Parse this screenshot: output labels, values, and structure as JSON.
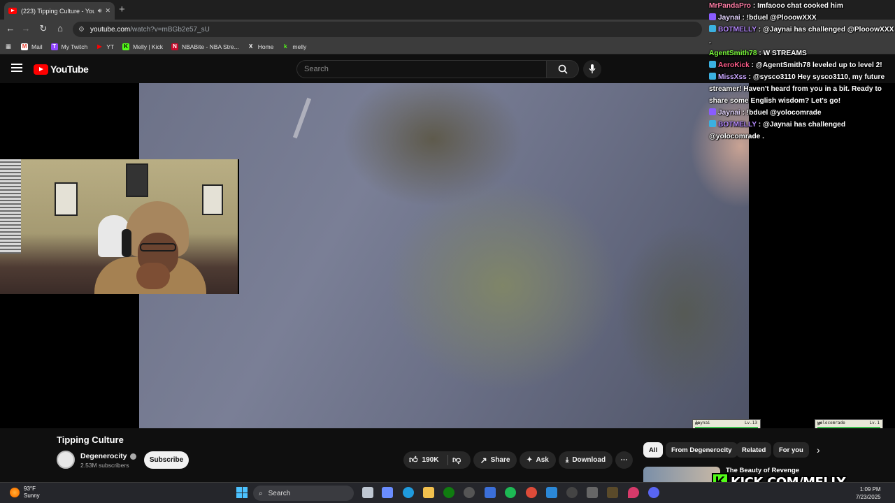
{
  "browser": {
    "tab_title": "(223) Tipping Culture - You",
    "new_tab": "+",
    "url_host": "youtube.com",
    "url_path": "/watch?v=mBGb2e57_sU",
    "bookmarks": [
      {
        "label": "Mail",
        "color": "#ea4335",
        "glyph": "M"
      },
      {
        "label": "My Twitch",
        "color": "#9146ff",
        "glyph": "T"
      },
      {
        "label": "YT",
        "color": "#ff0000",
        "glyph": "▶"
      },
      {
        "label": "Melly | Kick",
        "color": "#53fc18",
        "glyph": "K"
      },
      {
        "label": "NBABite - NBA Stre...",
        "color": "#c9082a",
        "glyph": "N"
      },
      {
        "label": "Home",
        "color": "#ffffff",
        "glyph": "X"
      },
      {
        "label": "melly",
        "color": "#53fc18",
        "glyph": "k"
      }
    ]
  },
  "youtube": {
    "logo": "YouTube",
    "search_placeholder": "Search",
    "video_title": "Tipping Culture",
    "channel_name": "Degenerocity",
    "subscribers": "2.53M subscribers",
    "subscribe_label": "Subscribe",
    "likes": "190K",
    "share_label": "Share",
    "ask_label": "Ask",
    "download_label": "Download",
    "more_label": "⋯",
    "chips": [
      "All",
      "From Degenerocity",
      "Related",
      "For you"
    ],
    "rec_title": "The Beauty of Revenge"
  },
  "chat": [
    {
      "user": "MrPandaPro",
      "user_color": "#ff7fa7",
      "text": "Imfaooo chat cooked him",
      "badge": ""
    },
    {
      "user": "Jaynai",
      "user_color": "#e6d7ff",
      "text": "!bduel @PlooowXXX",
      "badge": "#8a5cff"
    },
    {
      "user": "BOTMELLY",
      "user_color": "#b78aff",
      "text": "@Jaynai has challenged @PlooowXXX .",
      "badge": "#3bb0e0"
    },
    {
      "user": "AgentSmith78",
      "user_color": "#7cfc3c",
      "text": "W STREAMS",
      "badge": ""
    },
    {
      "user": "AeroKick",
      "user_color": "#ff5c8a",
      "text": "@AgentSmith78 leveled up to level 2!",
      "badge": "#3bb0e0"
    },
    {
      "user": "MissXss",
      "user_color": "#c9a6ff",
      "text": "@sysco3110 Hey sysco3110, my future streamer! Haven't heard from you in a bit. Ready to share some English wisdom? Let's go!",
      "badge": "#3bb0e0"
    },
    {
      "user": "Jaynai",
      "user_color": "#e6d7ff",
      "text": "!bduel @yolocomrade",
      "badge": "#8a5cff"
    },
    {
      "user": "BOTMELLY",
      "user_color": "#b78aff",
      "text": "@Jaynai has challenged @yolocomrade .",
      "badge": "#3bb0e0"
    }
  ],
  "duel": {
    "player1": "Jaynai",
    "player1_level": "Lv.13",
    "player2": "yolocomrade",
    "player2_level": "Lv.1",
    "hp_label": "HP",
    "player1_hp": 1.0,
    "player2_hp": 1.0
  },
  "overlay": {
    "kick_glyph": "K",
    "kick_text": "KICK.COM/MELLY"
  },
  "taskbar": {
    "temperature": "93°F",
    "condition": "Sunny",
    "search_label": "Search",
    "time": "1:09 PM",
    "date": "7/23/2025"
  }
}
